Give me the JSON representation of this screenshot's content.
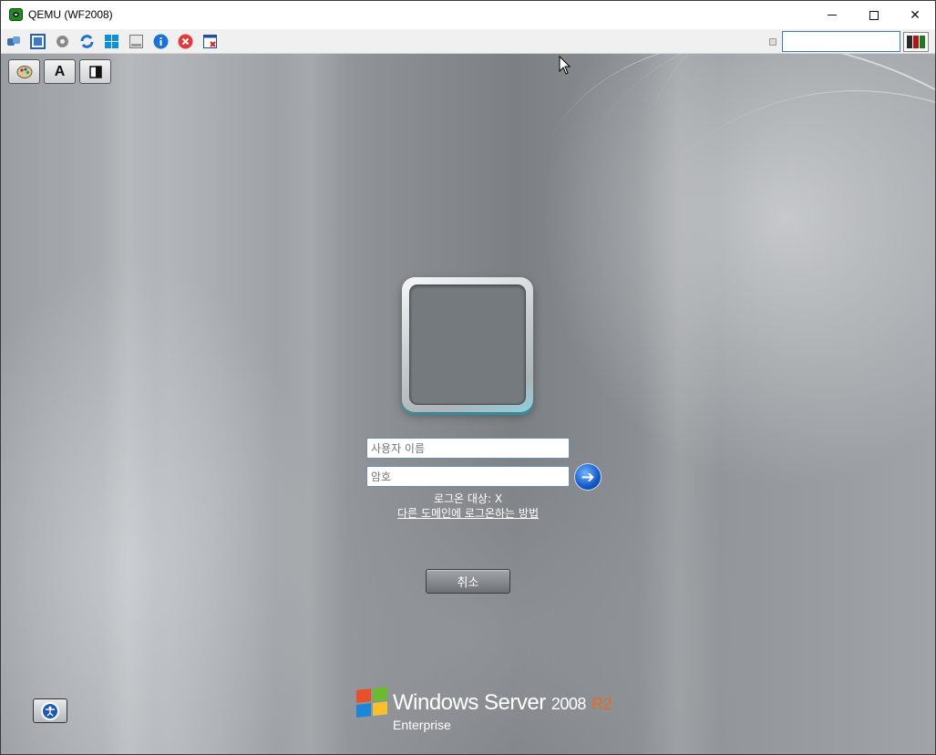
{
  "window": {
    "title": "QEMU (WF2008)",
    "controls": {
      "minimize": "minimize",
      "maximize": "maximize",
      "close": "✕"
    }
  },
  "toolbar": {
    "icons": [
      "devices-icon",
      "fullscreen-icon",
      "settings-icon",
      "refresh-icon",
      "windows-icon",
      "console-icon",
      "info-icon",
      "stop-icon",
      "disconnect-icon"
    ],
    "search_value": "",
    "colors": {
      "left": "#2a2a2a",
      "middle": "#b01818",
      "right": "#1d7a1d"
    }
  },
  "quick_buttons": {
    "palette": "palette-icon",
    "font_label": "A",
    "panel": "panel-icon"
  },
  "logon": {
    "username_placeholder": "사용자 이름",
    "password_placeholder": "암호",
    "logon_to": "로그온 대상: X",
    "other_domain_link": "다른 도메인에 로그온하는 방법",
    "cancel_label": "취소",
    "go_glyph": "➔"
  },
  "branding": {
    "product": "Windows Server",
    "version": "2008",
    "release": "R2",
    "edition": "Enterprise"
  },
  "ease_of_access": {
    "icon": "ease-of-access-icon"
  }
}
